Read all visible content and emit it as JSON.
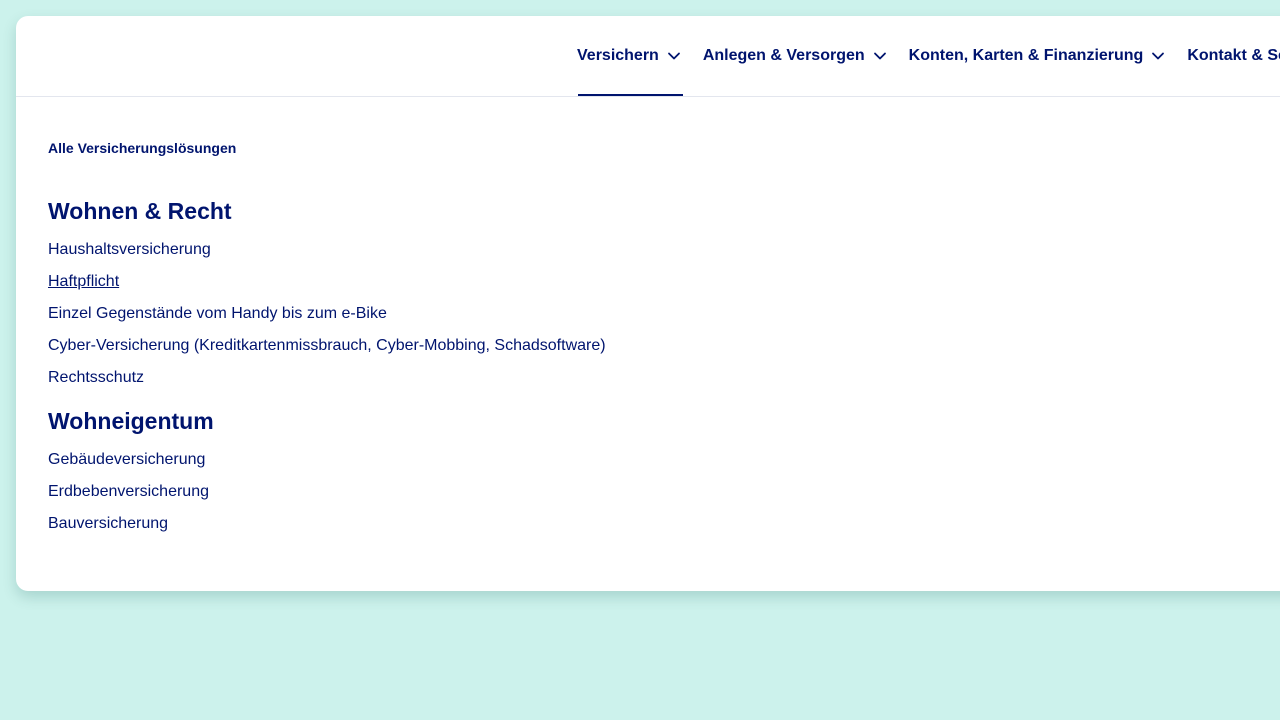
{
  "nav": {
    "items": [
      {
        "label": "Versichern",
        "active": true
      },
      {
        "label": "Anlegen & Versorgen",
        "active": false
      },
      {
        "label": "Konten, Karten & Finanzierung",
        "active": false
      },
      {
        "label": "Kontakt & Se",
        "active": false
      }
    ]
  },
  "menu": {
    "all_link": "Alle Versicherungslösungen",
    "sections": [
      {
        "title": "Wohnen & Recht",
        "links": [
          "Haushaltsversicherung",
          "Haftpflicht",
          "Einzel Gegenstände vom Handy bis zum e-Bike",
          "Cyber-Versicherung (Kreditkartenmissbrauch, Cyber-Mobbing, Schadsoftware)",
          "Rechtsschutz"
        ]
      },
      {
        "title": "Wohneigentum",
        "links": [
          "Gebäudeversicherung",
          "Erdbebenversicherung",
          "Bauversicherung"
        ]
      }
    ]
  },
  "colors": {
    "background": "#ccf2ec",
    "panel": "#ffffff",
    "text": "#00146e"
  }
}
